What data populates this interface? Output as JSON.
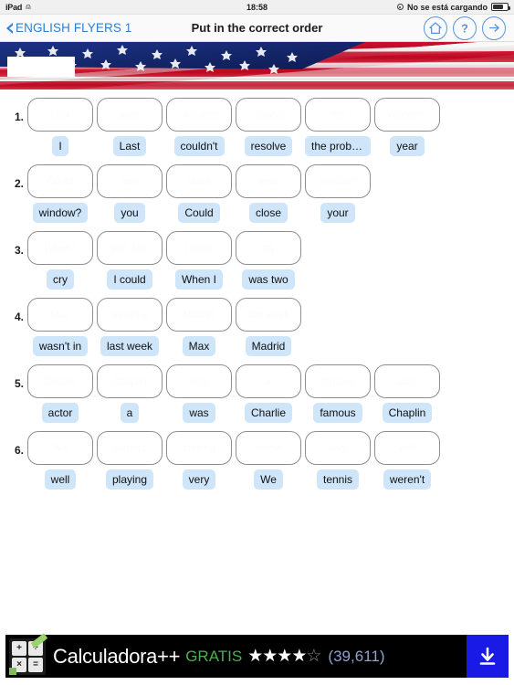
{
  "status_bar": {
    "device": "iPad",
    "wifi_icon": "wifi-icon",
    "time": "18:58",
    "charging_text": "No se está cargando",
    "charging_icon": "charging-indicator-icon",
    "battery_icon": "battery-icon"
  },
  "nav": {
    "back_label": "ENGLISH FLYERS 1",
    "back_icon": "chevron-left-icon",
    "title": "Put in the correct order",
    "actions": [
      {
        "name": "home-button",
        "icon": "home-icon"
      },
      {
        "name": "help-button",
        "icon": "question-mark-icon"
      },
      {
        "name": "next-button",
        "icon": "arrow-right-icon"
      }
    ]
  },
  "banner": {
    "image_name": "usa-flag-banner",
    "overlay_box_name": "flag-white-label-box"
  },
  "colors": {
    "accent_blue": "#2c7fd4",
    "tile_blue": "#cfe5f9",
    "slot_border": "#8e8e8e",
    "ad_background": "#000000",
    "ad_free_green": "#4caf50",
    "ad_download_blue": "#1a1ae6",
    "ad_count_blue": "#8fa3cf",
    "flag_red": "#c8102e",
    "flag_blue": "#16296b"
  },
  "exercises": [
    {
      "number": "1.",
      "slots": [
        "Last",
        "year",
        "I couldn't",
        "resolve",
        "the",
        "problem"
      ],
      "tiles": [
        "I",
        "Last",
        "couldn't",
        "resolve",
        "the probl…",
        "year"
      ]
    },
    {
      "number": "2.",
      "slots": [
        "Could",
        "you",
        "close",
        "your",
        "window?"
      ],
      "tiles": [
        "window?",
        "you",
        "Could",
        "close",
        "your"
      ]
    },
    {
      "number": "3.",
      "slots": [
        "When I",
        "was two",
        "I could",
        "cry"
      ],
      "tiles": [
        "cry",
        "I could",
        "When I",
        "was two"
      ]
    },
    {
      "number": "4.",
      "slots": [
        "Max",
        "wasn't in",
        "Madrid",
        "last week"
      ],
      "tiles": [
        "wasn't in",
        "last week",
        "Max",
        "Madrid"
      ]
    },
    {
      "number": "5.",
      "slots": [
        "Charlie",
        "Chaplin",
        "was",
        "a",
        "famous",
        "actor"
      ],
      "tiles": [
        "actor",
        "a",
        "was",
        "Charlie",
        "famous",
        "Chaplin"
      ]
    },
    {
      "number": "6.",
      "slots": [
        "We",
        "weren't",
        "playing",
        "tennis",
        "very",
        "well"
      ],
      "tiles": [
        "well",
        "playing",
        "very",
        "We",
        "tennis",
        "weren't"
      ]
    }
  ],
  "ad": {
    "app_icon": "calculator-app-icon",
    "icon_keys": [
      "+",
      "÷",
      "×",
      "="
    ],
    "title": "Calculadora++",
    "price_label": "GRATIS",
    "stars_full": "★★★★",
    "star_half": "☆",
    "rating_count": "(39,611)",
    "download_icon": "download-icon"
  }
}
